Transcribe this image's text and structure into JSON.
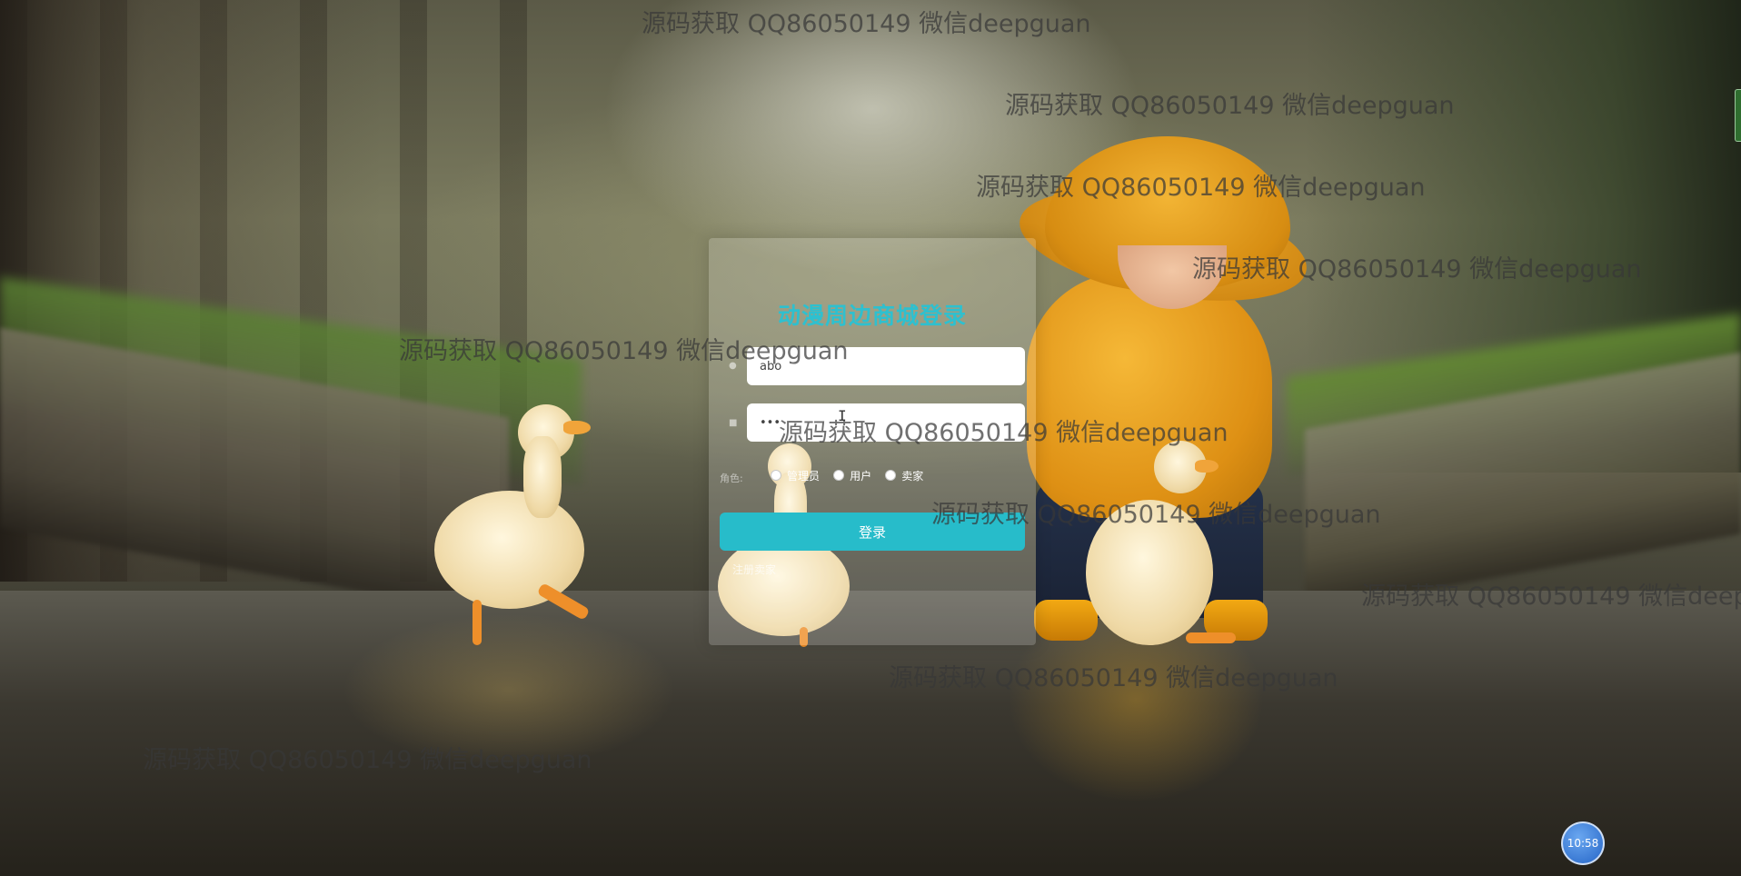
{
  "login": {
    "title": "动漫周边商城登录",
    "username": {
      "value": "abo"
    },
    "password": {
      "value": "•••"
    },
    "role_label": "角色:",
    "roles": [
      {
        "label": "管理员"
      },
      {
        "label": "用户"
      },
      {
        "label": "卖家"
      }
    ],
    "submit_label": "登录",
    "register_label": "注册卖家"
  },
  "watermark_text": "源码获取 QQ86050149 微信deepguan",
  "clock": {
    "time": "10:58"
  },
  "colors": {
    "accent": "#27bcca",
    "title": "#2ec0cf",
    "clock_bg": "#2565c7"
  },
  "icons": {
    "user": "user-icon",
    "lock": "lock-icon"
  }
}
